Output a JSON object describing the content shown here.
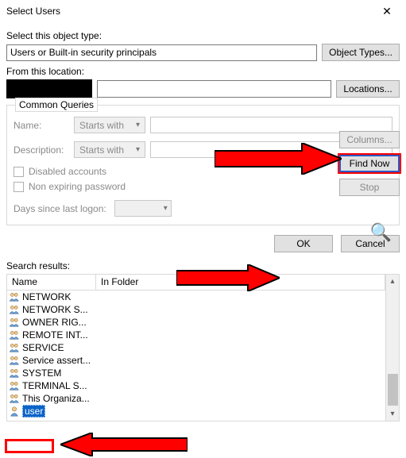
{
  "window": {
    "title": "Select Users",
    "close_tooltip": "Close"
  },
  "sections": {
    "object_type_label": "Select this object type:",
    "object_type_value": "Users or Built-in security principals",
    "object_types_button": "Object Types...",
    "from_location_label": "From this location:",
    "locations_button": "Locations..."
  },
  "common_queries": {
    "legend": "Common Queries",
    "name_label": "Name:",
    "name_mode": "Starts with",
    "description_label": "Description:",
    "description_mode": "Starts with",
    "disabled_accounts": "Disabled accounts",
    "non_expiring": "Non expiring password",
    "days_label": "Days since last logon:"
  },
  "side_buttons": {
    "columns": "Columns...",
    "find_now": "Find Now",
    "stop": "Stop"
  },
  "dialog_buttons": {
    "ok": "OK",
    "cancel": "Cancel"
  },
  "results": {
    "label": "Search results:",
    "col_name": "Name",
    "col_folder": "In Folder",
    "rows": [
      {
        "name": "NETWORK",
        "type": "group"
      },
      {
        "name": "NETWORK S...",
        "type": "group"
      },
      {
        "name": "OWNER RIG...",
        "type": "group"
      },
      {
        "name": "REMOTE INT...",
        "type": "group"
      },
      {
        "name": "SERVICE",
        "type": "group"
      },
      {
        "name": "Service assert...",
        "type": "group"
      },
      {
        "name": "SYSTEM",
        "type": "group"
      },
      {
        "name": "TERMINAL S...",
        "type": "group"
      },
      {
        "name": "This Organiza...",
        "type": "group"
      },
      {
        "name": "user",
        "type": "user",
        "selected": true
      }
    ]
  }
}
